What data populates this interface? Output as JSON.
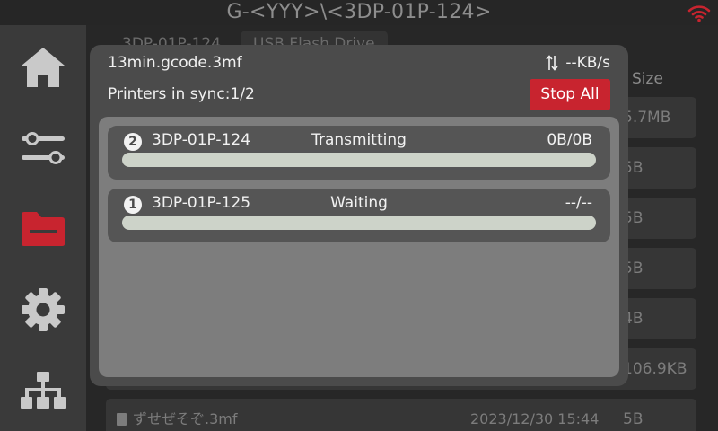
{
  "title": "G-<YYY>\\<3DP-01P-124>",
  "sidebar": {
    "items": [
      {
        "name": "home"
      },
      {
        "name": "controls"
      },
      {
        "name": "files",
        "active": true
      },
      {
        "name": "settings"
      },
      {
        "name": "network"
      }
    ],
    "active_color": "#c8242f",
    "icon_color": "#c9c9c9"
  },
  "background": {
    "tabs": [
      "3DP-01P-124",
      "USB Flash Drive"
    ],
    "size_header": "Size",
    "rows": [
      {
        "size": "5.7MB"
      },
      {
        "size": "5B"
      },
      {
        "size": "5B"
      },
      {
        "size": "5B"
      },
      {
        "size": "4B"
      },
      {
        "size": "106.9KB"
      },
      {
        "name": "ずせぜそぞ.3mf",
        "date": "2023/12/30 15:44",
        "size": "5B"
      }
    ]
  },
  "dialog": {
    "file_name": "13min.gcode.3mf",
    "speed": "--KB/s",
    "sync_label": "Printers in sync:1/2",
    "stop_all_label": "Stop All",
    "printers": [
      {
        "index": "2",
        "name": "3DP-01P-124",
        "status": "Transmitting",
        "amount": "0B/0B",
        "progress": 0
      },
      {
        "index": "1",
        "name": "3DP-01P-125",
        "status": "Waiting",
        "amount": "--/--",
        "progress": 0
      }
    ]
  },
  "colors": {
    "accent_red": "#c8242f",
    "wifi": "#c8242f",
    "progress_track": "#cdd3c9"
  }
}
